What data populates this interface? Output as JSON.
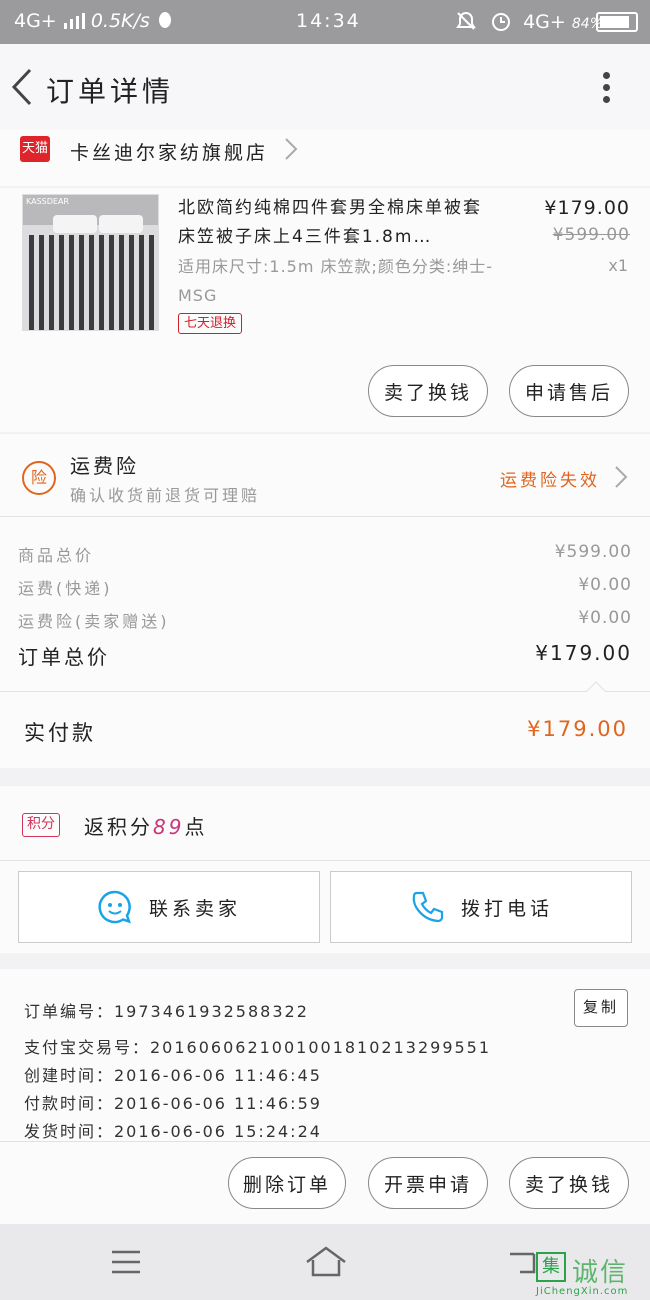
{
  "status_bar": {
    "network_left": "4G+",
    "speed": "0.5K/s",
    "time": "14:34",
    "network_right": "4G+",
    "battery": "84%",
    "battery_level": 0.84
  },
  "header": {
    "title": "订单详情",
    "back_icon": "chevron-left-icon",
    "more_icon": "more-vertical-icon"
  },
  "shop": {
    "badge": "天猫",
    "name": "卡丝迪尔家纺旗舰店"
  },
  "product": {
    "image_brand_text": "KASSDEAR",
    "title": "北欧简约纯棉四件套男全棉床单被套床笠被子床上4三件套1.8m…",
    "sku": "适用床尺寸:1.5m 床笠款;颜色分类:绅士-MSG",
    "tag": "七天退换",
    "price": "¥179.00",
    "original_price": "¥599.00",
    "quantity": "x1",
    "buttons": [
      "卖了换钱",
      "申请售后"
    ]
  },
  "insurance": {
    "icon_text": "险",
    "title": "运费险",
    "description": "确认收货前退货可理赔",
    "status": "运费险失效"
  },
  "summary": {
    "rows": [
      {
        "label": "商品总价",
        "value": "¥599.00"
      },
      {
        "label": "运费(快递)",
        "value": "¥0.00"
      },
      {
        "label": "运费险(卖家赠送)",
        "value": "¥0.00"
      }
    ],
    "total_label": "订单总价",
    "total_value": "¥179.00"
  },
  "payment": {
    "label": "实付款",
    "value": "¥179.00"
  },
  "points": {
    "badge": "积分",
    "prefix": "返积分",
    "number": "89",
    "suffix": "点"
  },
  "contact": {
    "seller_label": "联系卖家",
    "phone_label": "拨打电话",
    "seller_icon": "chat-bubble-icon",
    "phone_icon": "phone-icon"
  },
  "order_info": {
    "lines": [
      "订单编号：1973461932588322",
      "支付宝交易号：2016060621001001810213299551",
      "创建时间：2016-06-06 11:46:45",
      "付款时间：2016-06-06 11:46:59",
      "发货时间：2016-06-06 15:24:24"
    ],
    "copy_label": "复制"
  },
  "actions": [
    "删除订单",
    "开票申请",
    "卖了换钱"
  ],
  "watermark": {
    "logo_char": "集",
    "text": "诚信",
    "sub": "JiChengXin.com"
  },
  "colors": {
    "accent_orange": "#e0651e",
    "tmall_red": "#e0242c",
    "points_pink": "#c8357a",
    "chat_blue": "#1aa3e8"
  }
}
